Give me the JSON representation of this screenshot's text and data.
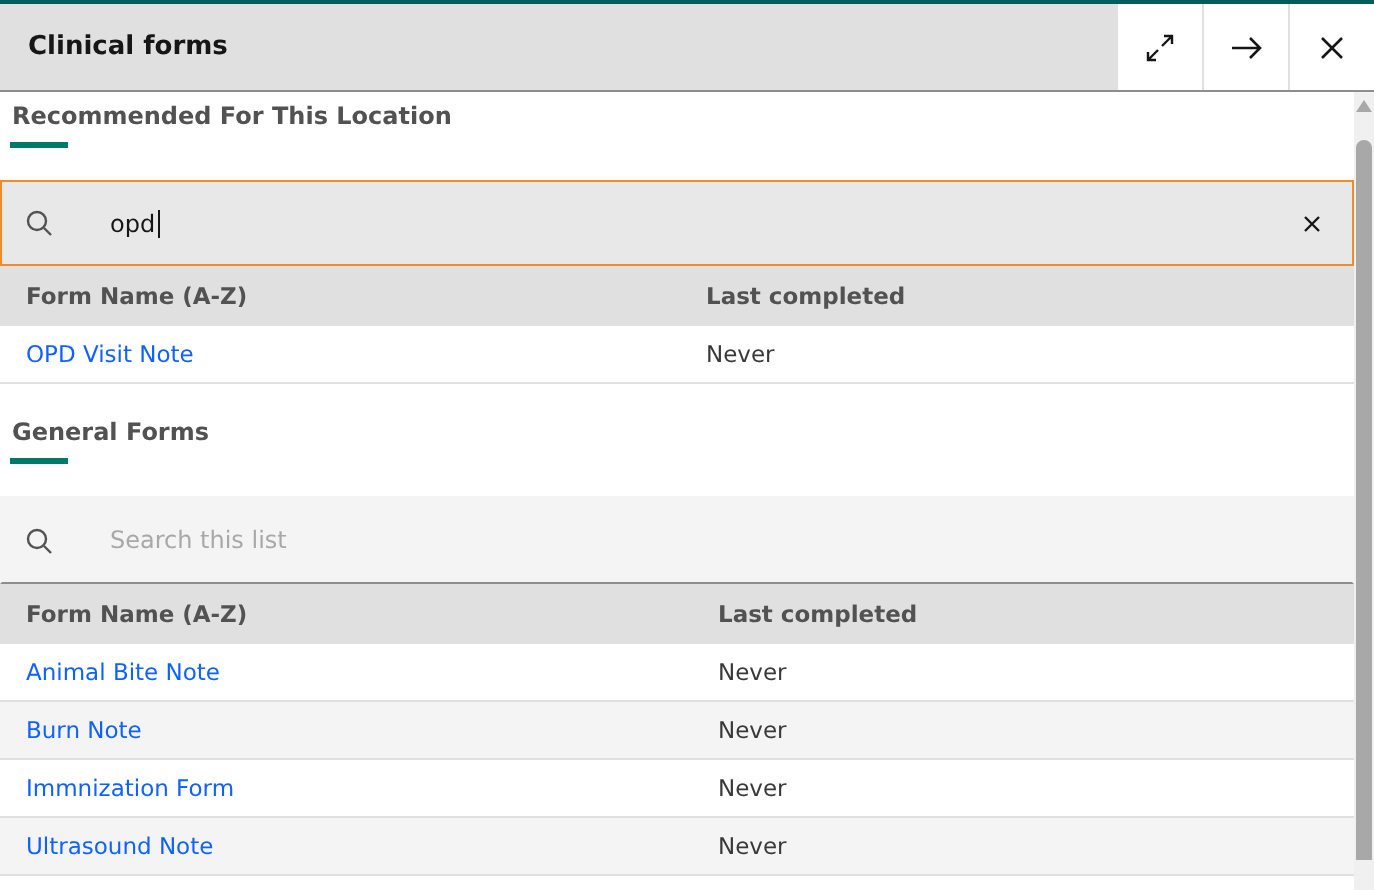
{
  "panel": {
    "title": "Clinical forms"
  },
  "sections": [
    {
      "title": "Recommended For This Location",
      "search": {
        "value": "opd",
        "focused": true
      },
      "columns": [
        "Form Name (A-Z)",
        "Last completed"
      ],
      "rows": [
        {
          "name": "OPD Visit Note",
          "last_completed": "Never"
        }
      ]
    },
    {
      "title": "General Forms",
      "search": {
        "placeholder": "Search this list",
        "focused": false
      },
      "columns": [
        "Form Name (A-Z)",
        "Last completed"
      ],
      "rows": [
        {
          "name": "Animal Bite Note",
          "last_completed": "Never"
        },
        {
          "name": "Burn Note",
          "last_completed": "Never"
        },
        {
          "name": "Immnization Form",
          "last_completed": "Never"
        },
        {
          "name": "Ultrasound Note",
          "last_completed": "Never"
        }
      ]
    }
  ]
}
